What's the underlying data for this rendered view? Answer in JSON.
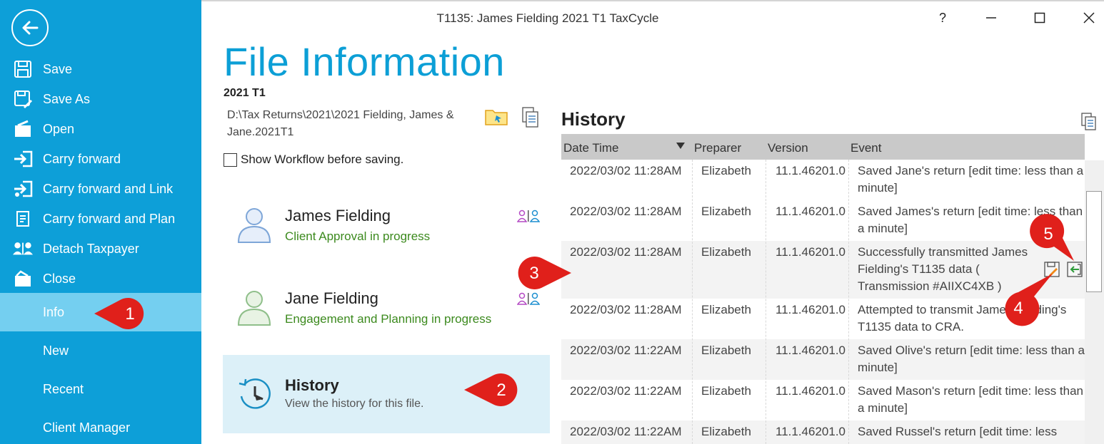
{
  "window": {
    "title": "T1135: James Fielding 2021 T1 TaxCycle",
    "help_label": "?",
    "minimize_label": "–",
    "maximize_label": "☐",
    "close_label": "✕"
  },
  "sidebar": {
    "back_icon": "back-arrow-icon",
    "items": [
      {
        "label": "Save",
        "icon": "save-icon"
      },
      {
        "label": "Save As",
        "icon": "save-as-icon"
      },
      {
        "label": "Open",
        "icon": "open-icon"
      },
      {
        "label": "Carry forward",
        "icon": "carry-forward-icon"
      },
      {
        "label": "Carry forward and Link",
        "icon": "carry-forward-link-icon"
      },
      {
        "label": "Carry forward and Plan",
        "icon": "carry-forward-plan-icon"
      },
      {
        "label": "Detach Taxpayer",
        "icon": "detach-taxpayer-icon"
      },
      {
        "label": "Close",
        "icon": "close-file-icon"
      },
      {
        "label": "Info"
      },
      {
        "label": "New"
      },
      {
        "label": "Recent"
      },
      {
        "label": "Client Manager"
      }
    ],
    "active_item": "Info"
  },
  "main": {
    "title": "File Information",
    "file_year": "2021 T1",
    "file_path": "D:\\Tax Returns\\2021\\2021 Fielding, James & Jane.2021T1",
    "workflow_checkbox_label": "Show Workflow before saving.",
    "workflow_checked": false,
    "taxpayers": [
      {
        "name": "James Fielding",
        "status": "Client Approval in progress",
        "avatar_color": "#7ea6d8"
      },
      {
        "name": "Jane Fielding",
        "status": "Engagement and Planning in progress",
        "avatar_color": "#8fbf8a"
      }
    ],
    "history_card": {
      "title": "History",
      "description": "View the history for this file."
    }
  },
  "history": {
    "title": "History",
    "columns": [
      "Date Time",
      "Preparer",
      "Version",
      "Event"
    ],
    "rows": [
      {
        "datetime": "2022/03/02 11:28AM",
        "preparer": "Elizabeth",
        "version": "11.1.46201.0",
        "event": "Saved Jane's return [edit time: less than a minute]"
      },
      {
        "datetime": "2022/03/02 11:28AM",
        "preparer": "Elizabeth",
        "version": "11.1.46201.0",
        "event": "Saved James's return [edit time: less than a minute]"
      },
      {
        "datetime": "2022/03/02 11:28AM",
        "preparer": "Elizabeth",
        "version": "11.1.46201.0",
        "event": "Successfully transmitted James Fielding's T1135 data ( Transmission #AIIXC4XB )"
      },
      {
        "datetime": "2022/03/02 11:28AM",
        "preparer": "Elizabeth",
        "version": "11.1.46201.0",
        "event": "Attempted to transmit James Fielding's T1135 data to CRA."
      },
      {
        "datetime": "2022/03/02 11:22AM",
        "preparer": "Elizabeth",
        "version": "11.1.46201.0",
        "event": "Saved Olive's return [edit time: less than a minute]"
      },
      {
        "datetime": "2022/03/02 11:22AM",
        "preparer": "Elizabeth",
        "version": "11.1.46201.0",
        "event": "Saved Mason's return [edit time: less than a minute]"
      },
      {
        "datetime": "2022/03/02 11:22AM",
        "preparer": "Elizabeth",
        "version": "11.1.46201.0",
        "event": "Saved Russel's return [edit time: less"
      }
    ]
  },
  "callouts": [
    "1",
    "2",
    "3",
    "4",
    "5"
  ],
  "colors": {
    "sidebar": "#0d9fd8",
    "sidebar_active": "#74cff0",
    "title": "#0c9fd6",
    "status_green": "#3c8a1e",
    "callout_red": "#e0201b",
    "history_card": "#dcf0f8"
  }
}
